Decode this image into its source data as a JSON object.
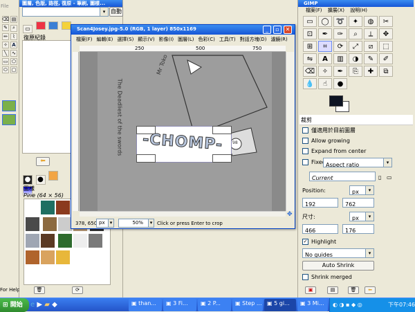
{
  "left_top": {
    "title": "圖層, 色版, 路徑, 復原 - 筆刷, 圖樣...",
    "file_menu": "File",
    "edit_menu": "Edit",
    "auto_button": "自動",
    "history_label": "復原紀錄"
  },
  "patterns": {
    "tab_label": "圖樣",
    "selected": "Pine (64 × 56)"
  },
  "image_window": {
    "title": "Scan4Josey.jpg-5.0 (RGB, 1 layer) 850x1169",
    "menu": [
      "檔案(F)",
      "編輯(E)",
      "選擇(S)",
      "顯示(V)",
      "影像(I)",
      "圖層(L)",
      "色彩(C)",
      "工具(T)",
      "對話方塊(D)",
      "濾鏡(R)"
    ],
    "ruler_marks": [
      "250",
      "500",
      "750"
    ],
    "canvas_text": {
      "mr": "Mr Toko",
      "side": "The Deadliest of the swords",
      "chomp": "-CHOMP-",
      "badge": "98"
    },
    "status": {
      "coords": "378, 650",
      "unit": "px",
      "zoom": "50%",
      "message": "Click or press Enter to crop"
    }
  },
  "gimp": {
    "title": "GIMP",
    "menus": [
      "檔案(F)",
      "擴展(X)",
      "說明(H)"
    ]
  },
  "crop_options": {
    "header": "裁剪",
    "current_layer_only": "僅適用於目前圖層",
    "allow_growing": "Allow growing",
    "expand_from_center": "Expand from center",
    "fixed_label": "Fixed:",
    "fixed_value": "Aspect ratio",
    "current": "Current",
    "position_label": "Position:",
    "position_unit": "px",
    "pos_x": "192",
    "pos_y": "762",
    "size_label": "尺寸:",
    "size_unit": "px",
    "size_w": "466",
    "size_h": "176",
    "highlight": "Highlight",
    "guides": "No guides",
    "auto_shrink": "Auto Shrink",
    "shrink_merged": "Shrink merged"
  },
  "statusbar": {
    "help": "For Help,"
  },
  "taskbar": {
    "start": "開始",
    "items": [
      "than...",
      "3 Fi...",
      "2 P...",
      "Step ...",
      "5 gi...",
      "3 Mi..."
    ],
    "tray_lang": "下午",
    "time": "07:46"
  }
}
